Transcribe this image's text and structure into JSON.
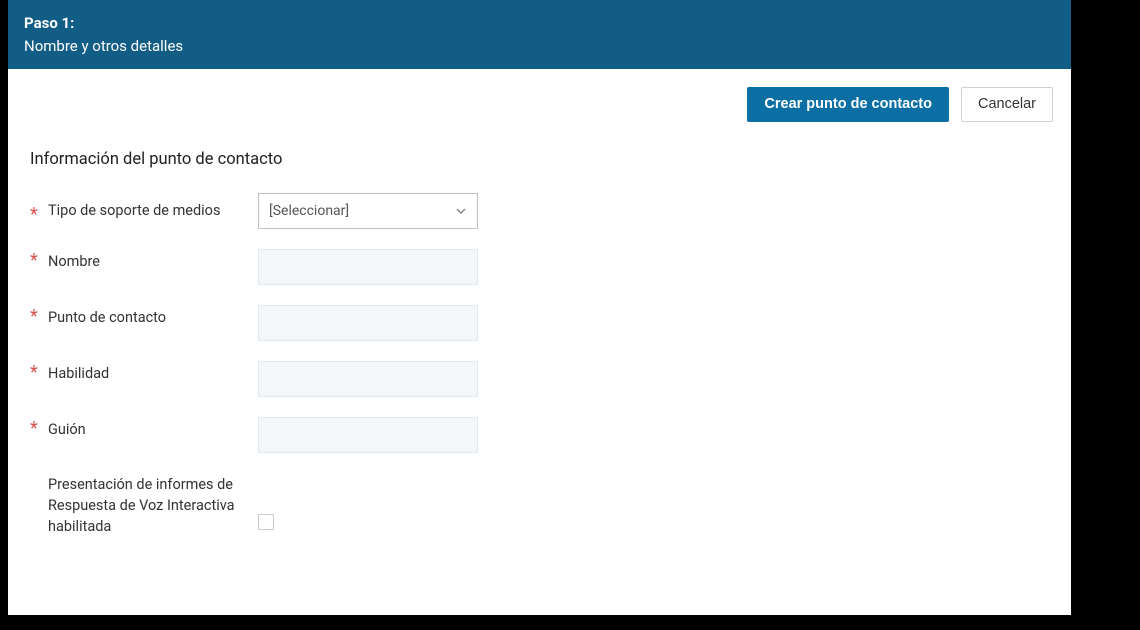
{
  "header": {
    "step_label": "Paso 1:",
    "step_subtitle": "Nombre y otros detalles"
  },
  "actions": {
    "primary": "Crear punto de contacto",
    "secondary": "Cancelar"
  },
  "section": {
    "title": "Información del punto de contacto"
  },
  "fields": {
    "media_type": {
      "label": "Tipo de soporte de medios",
      "placeholder": "[Seleccionar]"
    },
    "name": {
      "label": "Nombre",
      "value": ""
    },
    "contact_point": {
      "label": "Punto de contacto",
      "value": ""
    },
    "skill": {
      "label": "Habilidad",
      "value": ""
    },
    "script": {
      "label": "Guión",
      "value": ""
    },
    "ivr_reporting": {
      "label": "Presentación de informes de Respuesta de Voz Interactiva habilitada"
    }
  },
  "required_marker": "*"
}
